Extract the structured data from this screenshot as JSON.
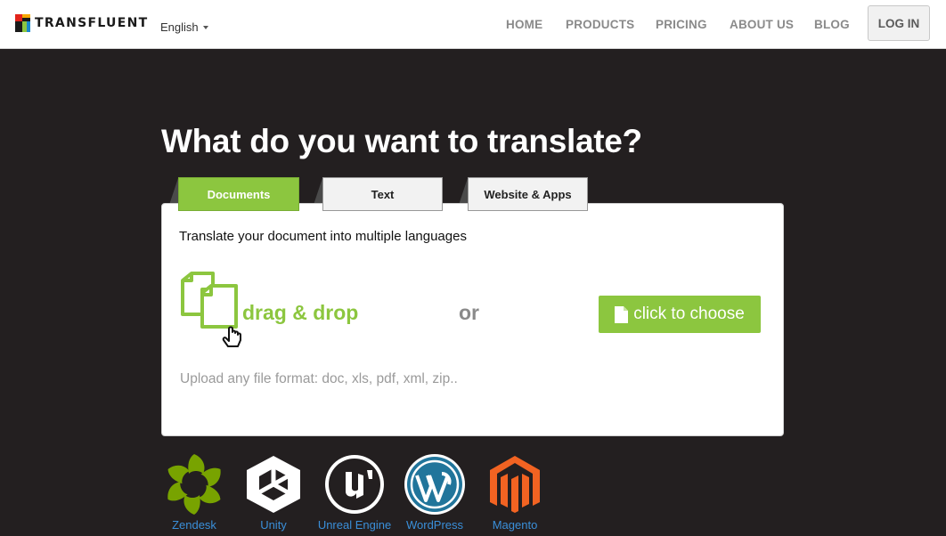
{
  "header": {
    "logo_text": "TRANSFLUENT",
    "language": "English",
    "nav": [
      "HOME",
      "PRODUCTS",
      "PRICING",
      "ABOUT US",
      "BLOG"
    ],
    "login": "LOG IN"
  },
  "main": {
    "headline": "What do you want to translate?",
    "tabs": [
      {
        "label": "Documents",
        "active": true
      },
      {
        "label": "Text",
        "active": false
      },
      {
        "label": "Website & Apps",
        "active": false
      }
    ],
    "panel": {
      "title": "Translate your document into multiple languages",
      "drag_label": "drag & drop",
      "or_label": "or",
      "choose_label": "click to choose",
      "formats_hint": "Upload any file format: doc, xls, pdf, xml, zip.."
    }
  },
  "integrations": [
    "Zendesk",
    "Unity",
    "Unreal Engine",
    "WordPress",
    "Magento"
  ],
  "colors": {
    "accent_green": "#8cc63f",
    "background_dark": "#231f20",
    "link_blue": "#3a8fd9"
  }
}
